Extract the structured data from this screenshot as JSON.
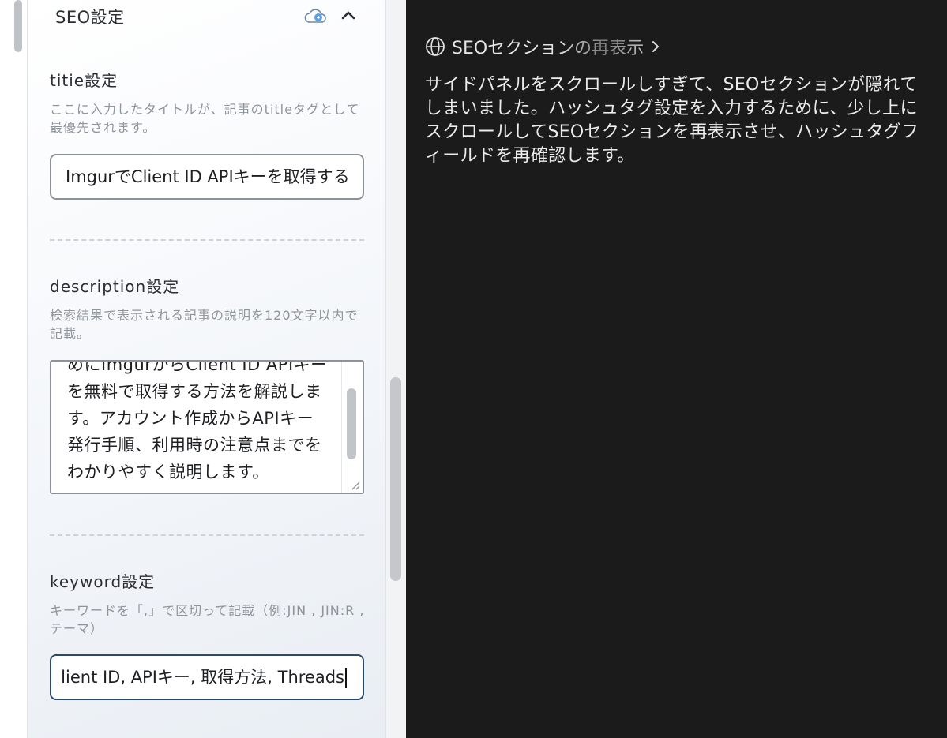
{
  "seo_panel": {
    "section_title": "SEO設定",
    "title_field": {
      "label": "titie設定",
      "help": "ここに入力したタイトルが、記事のtitleタグとして最優先されます。",
      "value": "ImgurでClient ID APIキーを取得する"
    },
    "description_field": {
      "label": "description設定",
      "help": "検索結果で表示される記事の説明を120文字以内で記載。",
      "value": "めにImgurからClient ID APIキーを無料で取得する方法を解説します。アカウント作成からAPIキー発行手順、利用時の注意点までをわかりやすく説明します。"
    },
    "keyword_field": {
      "label": "keyword設定",
      "help": "キーワードを「,」で区切って記載（例:JIN , JIN:R , テーマ）",
      "value": "lient ID, APIキー, 取得方法, Threads"
    }
  },
  "assistant": {
    "step_title": "SEOセクションの再表示",
    "step_body": "サイドパネルをスクロールしすぎて、SEOセクションが隠れてしまいました。ハッシュタグ設定を入力するために、少し上にスクロールしてSEOセクションを再表示させ、ハッシュタグフィールドを再確認します。"
  },
  "colors": {
    "dark_panel": "#1b1b1b",
    "focus_border": "#2b4a6a",
    "help_text": "#8f949b"
  },
  "icons": [
    "cloud-icon",
    "collapse-icon",
    "globe-icon",
    "chevron-right-icon",
    "resize-handle-icon"
  ]
}
